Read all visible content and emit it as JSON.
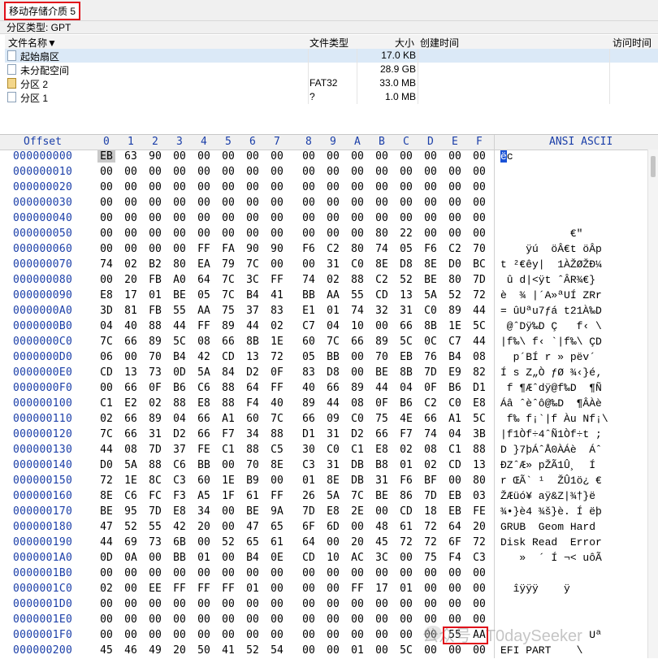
{
  "window": {
    "tab_title": "移动存储介质 5",
    "partition_type": "分区类型: GPT"
  },
  "file_list": {
    "columns": [
      "文件名称▼",
      "文件类型",
      "大小",
      "创建时间",
      "访问时间"
    ],
    "rows": [
      {
        "name": "起始扇区",
        "type": "",
        "size": "17.0 KB",
        "icon": "sector-icon",
        "selected": true
      },
      {
        "name": "未分配空间",
        "type": "",
        "size": "28.9 GB",
        "icon": "sector-icon",
        "selected": false
      },
      {
        "name": "分区 2",
        "type": "FAT32",
        "size": "33.0 MB",
        "icon": "partition-icon",
        "selected": false
      },
      {
        "name": "分区 1",
        "type": "?",
        "size": "1.0 MB",
        "icon": "sector-icon",
        "selected": false
      }
    ]
  },
  "hex_view": {
    "offset_header": "Offset",
    "col_headers": [
      "0",
      "1",
      "2",
      "3",
      "4",
      "5",
      "6",
      "7",
      "8",
      "9",
      "A",
      "B",
      "C",
      "D",
      "E",
      "F"
    ],
    "ascii_header": "ANSI ASCII",
    "rows": [
      {
        "offset": "000000000",
        "bytes": "EB 63 90 00 00 00 00 00 00 00 00 00 00 00 00 00",
        "ascii": "ëc"
      },
      {
        "offset": "000000010",
        "bytes": "00 00 00 00 00 00 00 00 00 00 00 00 00 00 00 00",
        "ascii": ""
      },
      {
        "offset": "000000020",
        "bytes": "00 00 00 00 00 00 00 00 00 00 00 00 00 00 00 00",
        "ascii": ""
      },
      {
        "offset": "000000030",
        "bytes": "00 00 00 00 00 00 00 00 00 00 00 00 00 00 00 00",
        "ascii": ""
      },
      {
        "offset": "000000040",
        "bytes": "00 00 00 00 00 00 00 00 00 00 00 00 00 00 00 00",
        "ascii": ""
      },
      {
        "offset": "000000050",
        "bytes": "00 00 00 00 00 00 00 00 00 00 00 80 22 00 00 00",
        "ascii": "           €\""
      },
      {
        "offset": "000000060",
        "bytes": "00 00 00 00 FF FA 90 90 F6 C2 80 74 05 F6 C2 70",
        "ascii": "    ÿú  öÂ€t öÂp"
      },
      {
        "offset": "000000070",
        "bytes": "74 02 B2 80 EA 79 7C 00 00 31 C0 8E D8 8E D0 BC",
        "ascii": "t ²€êy|  1ÀŽØŽÐ¼"
      },
      {
        "offset": "000000080",
        "bytes": "00 20 FB A0 64 7C 3C FF 74 02 88 C2 52 BE 80 7D",
        "ascii": " û d|<ÿt ˆÂR¾€}"
      },
      {
        "offset": "000000090",
        "bytes": "E8 17 01 BE 05 7C B4 41 BB AA 55 CD 13 5A 52 72",
        "ascii": "è  ¾ |´A»ªUÍ ZRr"
      },
      {
        "offset": "0000000A0",
        "bytes": "3D 81 FB 55 AA 75 37 83 E1 01 74 32 31 C0 89 44",
        "ascii": "= ûUªu7ƒá t21À‰D"
      },
      {
        "offset": "0000000B0",
        "bytes": "04 40 88 44 FF 89 44 02 C7 04 10 00 66 8B 1E 5C",
        "ascii": " @ˆDÿ‰D Ç   f‹ \\"
      },
      {
        "offset": "0000000C0",
        "bytes": "7C 66 89 5C 08 66 8B 1E 60 7C 66 89 5C 0C C7 44",
        "ascii": "|f‰\\ f‹ `|f‰\\ ÇD"
      },
      {
        "offset": "0000000D0",
        "bytes": "06 00 70 B4 42 CD 13 72 05 BB 00 70 EB 76 B4 08",
        "ascii": "  p´BÍ r » pëv´"
      },
      {
        "offset": "0000000E0",
        "bytes": "CD 13 73 0D 5A 84 D2 0F 83 D8 00 BE 8B 7D E9 82",
        "ascii": "Í s Z„Ò ƒØ ¾‹}é‚"
      },
      {
        "offset": "0000000F0",
        "bytes": "00 66 0F B6 C6 88 64 FF 40 66 89 44 04 0F B6 D1",
        "ascii": " f ¶Æˆdÿ@f‰D  ¶Ñ"
      },
      {
        "offset": "000000100",
        "bytes": "C1 E2 02 88 E8 88 F4 40 89 44 08 0F B6 C2 C0 E8",
        "ascii": "Áâ ˆèˆô@‰D  ¶ÂÀè"
      },
      {
        "offset": "000000110",
        "bytes": "02 66 89 04 66 A1 60 7C 66 09 C0 75 4E 66 A1 5C",
        "ascii": " f‰ f¡`|f Àu Nf¡\\"
      },
      {
        "offset": "000000120",
        "bytes": "7C 66 31 D2 66 F7 34 88 D1 31 D2 66 F7 74 04 3B",
        "ascii": "|f1Òf÷4ˆÑ1Òf÷t ;"
      },
      {
        "offset": "000000130",
        "bytes": "44 08 7D 37 FE C1 88 C5 30 C0 C1 E8 02 08 C1 88",
        "ascii": "D }7þÁˆÅ0ÀÁè  Áˆ"
      },
      {
        "offset": "000000140",
        "bytes": "D0 5A 88 C6 BB 00 70 8E C3 31 DB B8 01 02 CD 13",
        "ascii": "ÐZˆÆ» pŽÃ1Û¸  Í"
      },
      {
        "offset": "000000150",
        "bytes": "72 1E 8C C3 60 1E B9 00 01 8E DB 31 F6 BF 00 80",
        "ascii": "r ŒÃ` ¹  ŽÛ1ö¿ €"
      },
      {
        "offset": "000000160",
        "bytes": "8E C6 FC F3 A5 1F 61 FF 26 5A 7C BE 86 7D EB 03",
        "ascii": "ŽÆüó¥ aÿ&Z|¾†}ë"
      },
      {
        "offset": "000000170",
        "bytes": "BE 95 7D E8 34 00 BE 9A 7D E8 2E 00 CD 18 EB FE",
        "ascii": "¾•}è4 ¾š}è. Í ëþ"
      },
      {
        "offset": "000000180",
        "bytes": "47 52 55 42 20 00 47 65 6F 6D 00 48 61 72 64 20",
        "ascii": "GRUB  Geom Hard"
      },
      {
        "offset": "000000190",
        "bytes": "44 69 73 6B 00 52 65 61 64 00 20 45 72 72 6F 72",
        "ascii": "Disk Read  Error"
      },
      {
        "offset": "0000001A0",
        "bytes": "0D 0A 00 BB 01 00 B4 0E CD 10 AC 3C 00 75 F4 C3",
        "ascii": "   »  ´ Í ¬< uôÃ"
      },
      {
        "offset": "0000001B0",
        "bytes": "00 00 00 00 00 00 00 00 00 00 00 00 00 00 00 00",
        "ascii": ""
      },
      {
        "offset": "0000001C0",
        "bytes": "02 00 EE FF FF FF 01 00 00 00 FF 17 01 00 00 00",
        "ascii": "  îÿÿÿ    ÿ"
      },
      {
        "offset": "0000001D0",
        "bytes": "00 00 00 00 00 00 00 00 00 00 00 00 00 00 00 00",
        "ascii": ""
      },
      {
        "offset": "0000001E0",
        "bytes": "00 00 00 00 00 00 00 00 00 00 00 00 00 00 00 00",
        "ascii": ""
      },
      {
        "offset": "0000001F0",
        "bytes": "00 00 00 00 00 00 00 00 00 00 00 00 00 00 55 AA",
        "ascii": "              Uª"
      },
      {
        "offset": "000000200",
        "bytes": "45 46 49 20 50 41 52 54 00 00 01 00 5C 00 00 00",
        "ascii": "EFI PART    \\"
      }
    ]
  },
  "watermark": "公众号 · T0daySeeker"
}
